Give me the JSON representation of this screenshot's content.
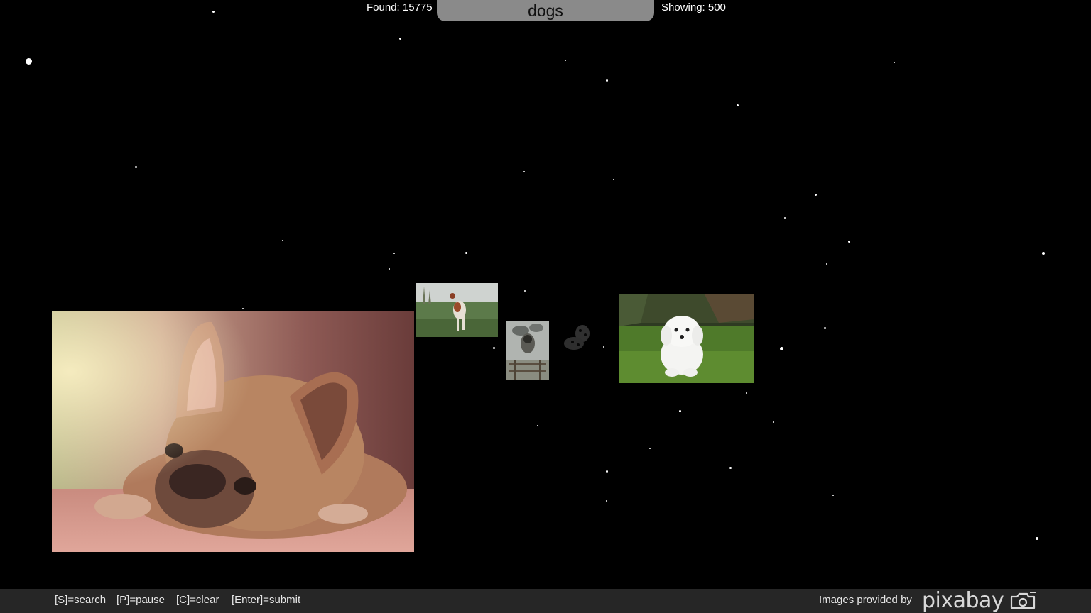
{
  "header": {
    "found_label": "Found: 15775",
    "search_query": "dogs",
    "showing_label": "Showing: 500"
  },
  "gallery": {
    "images": [
      {
        "subject": "french bulldog lying down",
        "name": "photo-french-bulldog"
      },
      {
        "subject": "dog leaping in grass field",
        "name": "photo-dog-field"
      },
      {
        "subject": "dogs stacked on fence",
        "name": "photo-dogs-fence"
      },
      {
        "subject": "faded dalmatian",
        "name": "photo-dalmatian-faded"
      },
      {
        "subject": "white puppy on grass",
        "name": "photo-white-puppy"
      }
    ]
  },
  "footer": {
    "shortcuts": {
      "search": "[S]=search",
      "pause": "[P]=pause",
      "clear": "[C]=clear",
      "submit": "[Enter]=submit"
    },
    "credit_label": "Images provided by",
    "logo_text": "pixabay"
  },
  "colors": {
    "background": "#000000",
    "search_box": "#8a8a8a",
    "footer_bar": "#262626",
    "text": "#ffffff"
  },
  "icons": [
    "pixabay-camera-icon"
  ]
}
